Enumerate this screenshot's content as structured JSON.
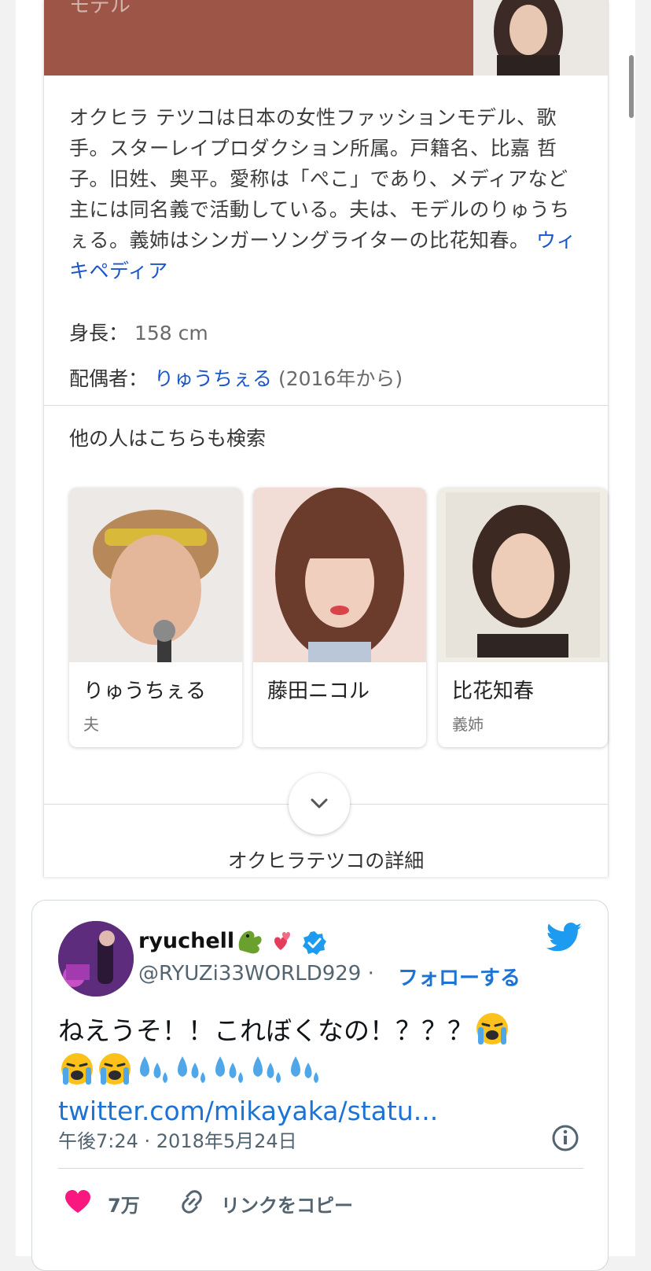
{
  "knowledge_panel": {
    "header_label": "モデル",
    "description": "オクヒラ テツコは日本の女性ファッションモデル、歌手。スターレイプロダクション所属。戸籍名、比嘉 哲子。旧姓、奥平。愛称は「ぺこ」であり、メディアなど主には同名義で活動している。夫は、モデルのりゅうちぇる。義姉はシンガーソングライターの比花知春。",
    "source_link": "ウィキペディア",
    "facts": [
      {
        "label": "身長：",
        "value": "158 cm"
      },
      {
        "label": "配偶者：",
        "link": "りゅうちぇる",
        "value": "(2016年から)"
      }
    ],
    "also_search_title": "他の人はこちらも検索",
    "people": [
      {
        "name": "りゅうちぇる",
        "relation": "夫"
      },
      {
        "name": "藤田ニコル",
        "relation": ""
      },
      {
        "name": "比花知春",
        "relation": "義姉"
      }
    ],
    "more_details": "オクヒラテツコの詳細",
    "expand_icon": "chevron-down-icon"
  },
  "tweet": {
    "name": "ryuchell",
    "handle": "@RYUZi33WORLD929",
    "separator": "·",
    "follow_label": "フォローする",
    "text_line1": "ねえうそ！！これぼくなの！？？？",
    "link_text": "twitter.com/mikayaka/statu...",
    "timestamp": "午後7:24 · 2018年5月24日",
    "likes": "7万",
    "copy_link_label": "リンクをコピー",
    "colors": {
      "link": "#1d73d4",
      "heart": "#f91880",
      "bird": "#1d9bf0"
    }
  }
}
